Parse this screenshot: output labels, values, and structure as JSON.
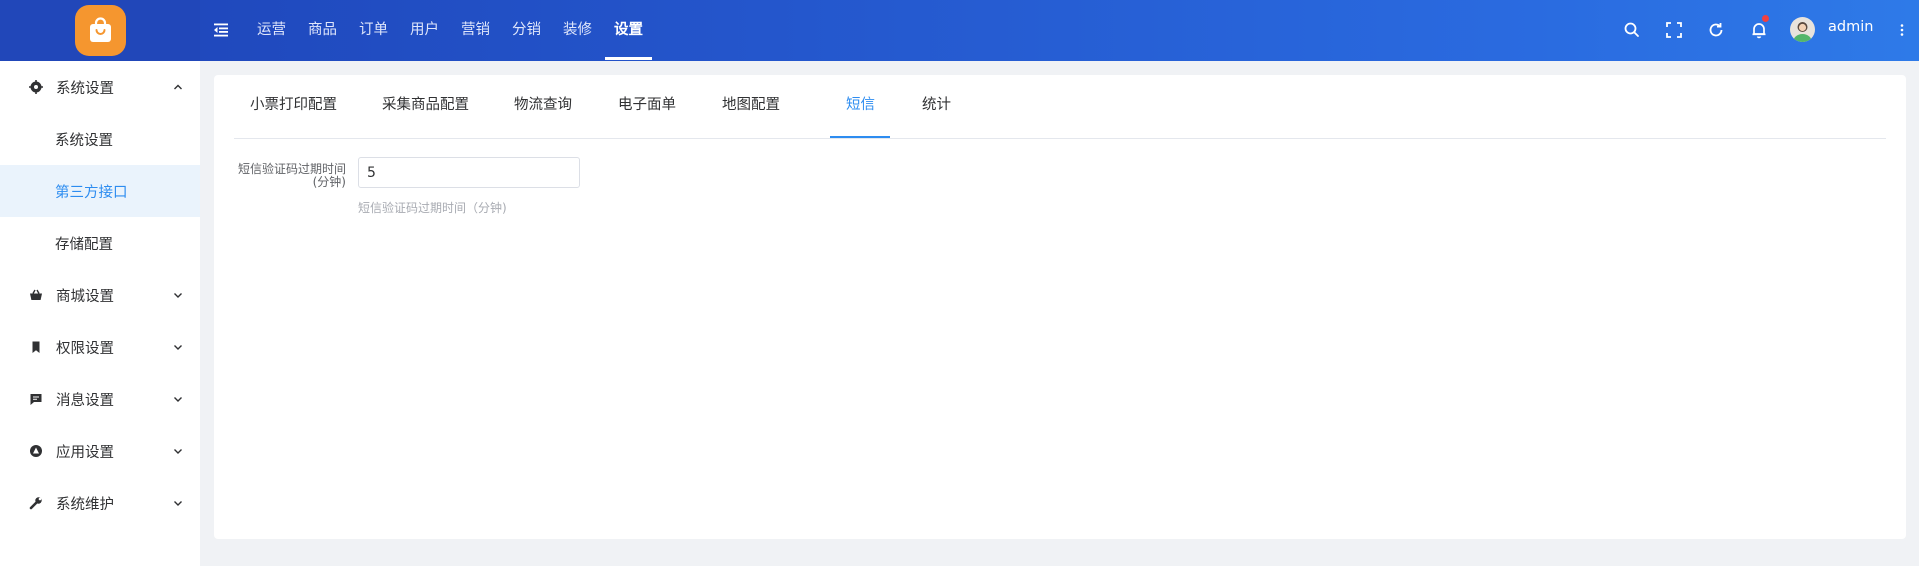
{
  "header": {
    "logo_icon": "shopping-bag-icon",
    "nav": [
      {
        "label": "运营"
      },
      {
        "label": "商品"
      },
      {
        "label": "订单"
      },
      {
        "label": "用户"
      },
      {
        "label": "营销"
      },
      {
        "label": "分销"
      },
      {
        "label": "装修"
      },
      {
        "label": "设置",
        "active": true
      }
    ],
    "username": "admin",
    "icons": [
      "search-icon",
      "fullscreen-icon",
      "refresh-icon",
      "bell-icon",
      "more-vertical-icon"
    ],
    "accent": "#2456cc"
  },
  "sidebar": {
    "groups": [
      {
        "label": "系统设置",
        "icon": "gear-icon",
        "expanded": true
      },
      {
        "label": "商城设置",
        "icon": "basket-icon"
      },
      {
        "label": "权限设置",
        "icon": "bookmark-icon"
      },
      {
        "label": "消息设置",
        "icon": "message-icon"
      },
      {
        "label": "应用设置",
        "icon": "compass-icon"
      },
      {
        "label": "系统维护",
        "icon": "wrench-icon"
      }
    ],
    "subitems": [
      {
        "label": "系统设置"
      },
      {
        "label": "第三方接口",
        "active": true
      },
      {
        "label": "存储配置"
      }
    ]
  },
  "content": {
    "tabs": [
      {
        "label": "小票打印配置"
      },
      {
        "label": "采集商品配置"
      },
      {
        "label": "物流查询"
      },
      {
        "label": "电子面单"
      },
      {
        "label": "地图配置"
      },
      {
        "label": "短信",
        "active": true
      },
      {
        "label": "统计"
      }
    ],
    "form": {
      "label_line1": "短信验证码过期时间",
      "label_line2": "(分钟)",
      "value": "5",
      "help": "短信验证码过期时间（分钟)"
    },
    "active_color": "#2d8cf0"
  }
}
